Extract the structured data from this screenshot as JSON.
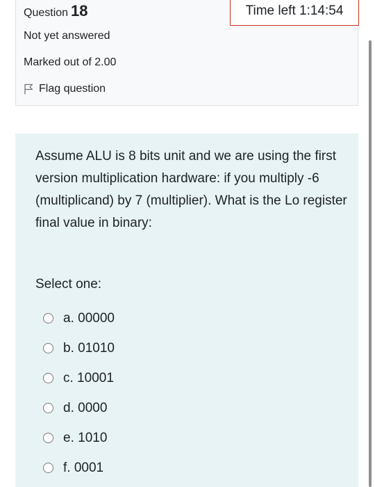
{
  "question_info": {
    "label": "Question",
    "number": "18",
    "state": "Not yet answered",
    "grade": "Marked out of 2.00",
    "flag_label": "Flag question"
  },
  "timer": {
    "text": "Time left 1:14:54"
  },
  "question": {
    "text": "Assume ALU is 8 bits unit and we are using the first version multiplication hardware: if you multiply -6 (multiplicand) by 7 (multiplier). What is the Lo register final value in binary:",
    "prompt": "Select one:",
    "options": [
      "a. 00000",
      "b. 01010",
      "c. 10001",
      "d. 0000",
      "e. 1010",
      "f. 0001"
    ]
  },
  "colors": {
    "info_background": "#f8f9fa",
    "formulation_background": "#e7f3f5",
    "timer_border": "#ca3120"
  },
  "icons": {
    "flag": "flag-outline-icon",
    "radio": "radio-unchecked-icon"
  }
}
